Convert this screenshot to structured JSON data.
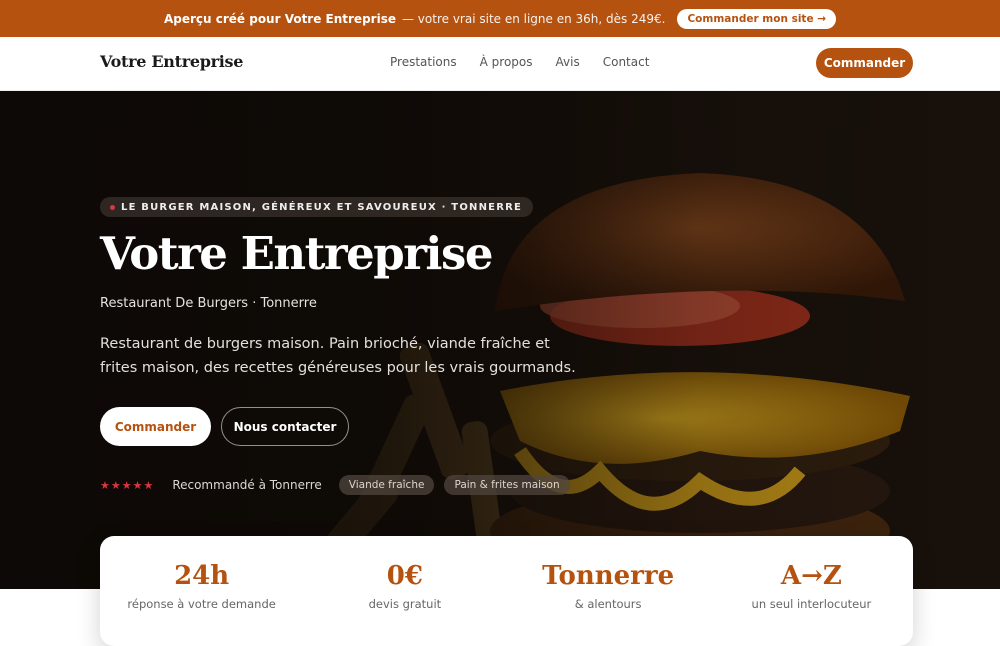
{
  "promo": {
    "strong": "Aperçu créé pour Votre Entreprise",
    "text": "— votre vrai site en ligne en 36h, dès 249€.",
    "button": "Commander mon site →"
  },
  "nav": {
    "logo": "Votre Entreprise",
    "links": [
      "Prestations",
      "À propos",
      "Avis",
      "Contact"
    ],
    "cta": "Commander"
  },
  "hero": {
    "eyebrow": "LE BURGER MAISON, GÉNÉREUX ET SAVOUREUX · TONNERRE",
    "title": "Votre Entreprise",
    "subtitle": "Restaurant De Burgers · Tonnerre",
    "description": "Restaurant de burgers maison. Pain brioché, viande fraîche et frites maison, des recettes généreuses pour les vrais gourmands.",
    "primary_button": "Commander",
    "secondary_button": "Nous contacter",
    "stars": "★★★★★",
    "trust_text": "Recommandé à Tonnerre",
    "chips": [
      "Viande fraîche",
      "Pain & frites maison"
    ]
  },
  "stats": [
    {
      "value": "24h",
      "label": "réponse à votre demande"
    },
    {
      "value": "0€",
      "label": "devis gratuit"
    },
    {
      "value": "Tonnerre",
      "label": "& alentours"
    },
    {
      "value": "A→Z",
      "label": "un seul interlocuteur"
    }
  ],
  "colors": {
    "accent": "#b5520f",
    "star": "#d9363e"
  }
}
